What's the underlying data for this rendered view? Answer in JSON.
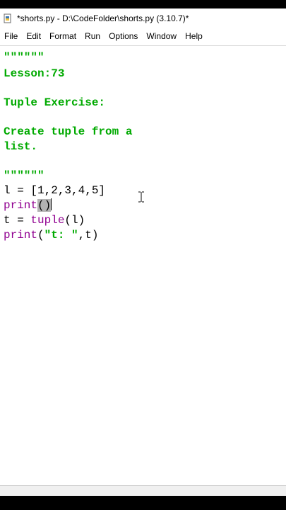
{
  "window": {
    "title": "*shorts.py - D:\\CodeFolder\\shorts.py (3.10.7)*",
    "icon": "python-file-icon"
  },
  "menu": [
    "File",
    "Edit",
    "Format",
    "Run",
    "Options",
    "Window",
    "Help"
  ],
  "code": {
    "doc_open": "\"\"\"\"\"\"",
    "lesson": "Lesson:73",
    "topic": "Tuple Exercise:",
    "desc_line1": "Create tuple from a",
    "desc_line2": "list.",
    "doc_close": "\"\"\"\"\"\"",
    "line1": "l = [1,2,3,4,5]",
    "line2_func": "print",
    "line2_parens": "()",
    "line3_left": "t = ",
    "line3_func": "tuple",
    "line3_args": "(l)",
    "line4_func": "print",
    "line4_open": "(",
    "line4_str": "\"t: \"",
    "line4_rest": ",t)"
  },
  "colors": {
    "comment_string": "#00aa00",
    "builtin": "#900090",
    "selection": "#b3b3b3"
  }
}
